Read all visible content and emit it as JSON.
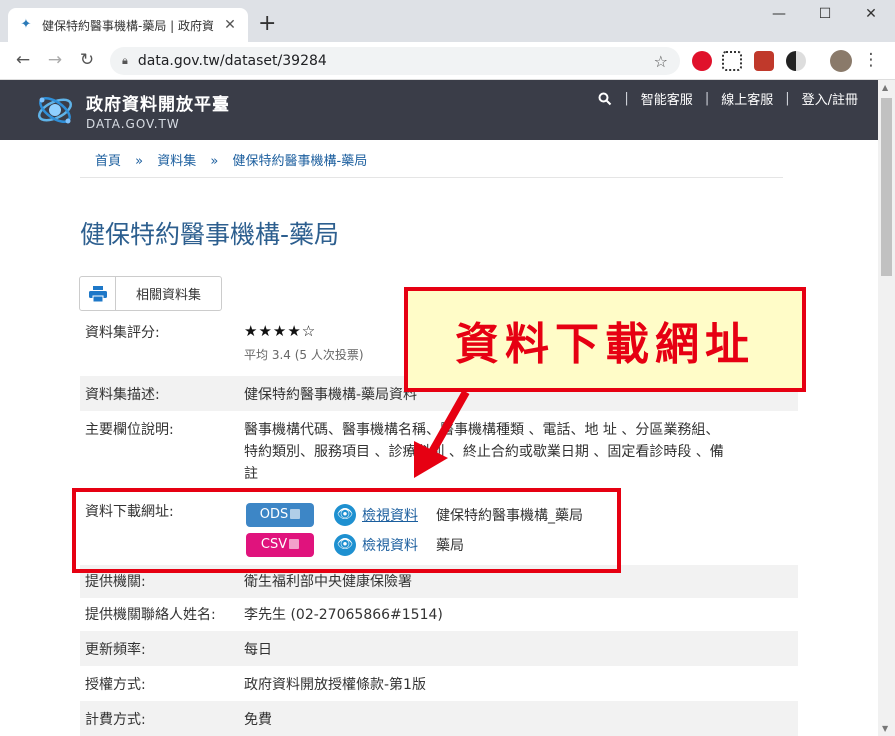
{
  "browser": {
    "tab_title": "健保特約醫事機構-藥局 | 政府資",
    "url": "data.gov.tw/dataset/39284"
  },
  "site": {
    "logo_zh": "政府資料開放平臺",
    "logo_en": "DATA.GOV.TW",
    "nav": [
      "智能客服",
      "線上客服",
      "登入/註冊"
    ]
  },
  "breadcrumb": [
    "首頁",
    "資料集",
    "健保特約醫事機構-藥局"
  ],
  "page_title": "健保特約醫事機構-藥局",
  "buttons": {
    "related": "相關資料集"
  },
  "rating": {
    "label": "資料集評分:",
    "stars": 4,
    "max": 5,
    "stars_text": "★★★★☆",
    "summary": "平均 3.4 (5 人次投票)"
  },
  "fields": {
    "desc_label": "資料集描述:",
    "desc_value": "健保特約醫事機構-藥局資料",
    "cols_label": "主要欄位說明:",
    "cols_value_1": "醫事機構代碼、醫事機構名稱、醫事機構種類 、電話、地 址 、分區業務組、",
    "cols_value_2": "特約類別、服務項目 、診療科別 、終止合約或歇業日期 、固定看診時段 、備",
    "cols_value_3": "註",
    "download_label": "資料下載網址:",
    "provider_label": "提供機關:",
    "provider_value": "衛生福利部中央健康保險署",
    "contact_label": "提供機關聯絡人姓名:",
    "contact_value": "李先生 (02-27065866#1514)",
    "freq_label": "更新頻率:",
    "freq_value": "每日",
    "license_label": "授權方式:",
    "license_value": "政府資料開放授權條款-第1版",
    "fee_label": "計費方式:",
    "fee_value": "免費"
  },
  "downloads": [
    {
      "format": "ODS",
      "color": "#3d86c6",
      "view": "檢視資料",
      "desc": "健保特約醫事機構_藥局"
    },
    {
      "format": "CSV",
      "color": "#e0137d",
      "view": "檢視資料",
      "desc": "藥局"
    }
  ],
  "annotation": {
    "callout_text": "資料下載網址",
    "color": "#e60012"
  }
}
